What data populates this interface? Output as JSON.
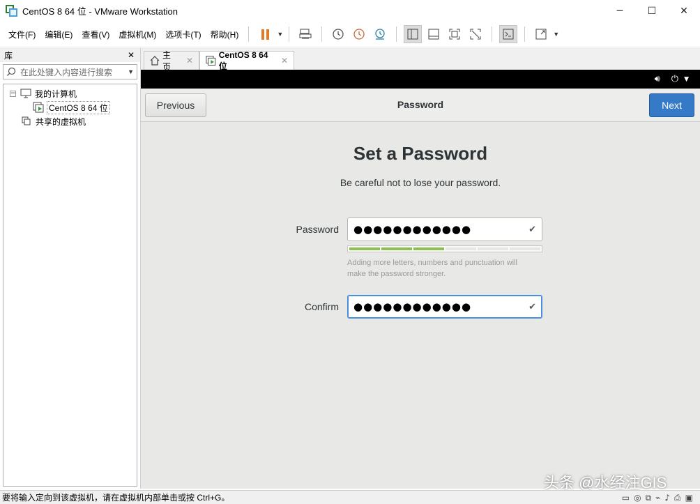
{
  "window": {
    "title": "CentOS 8 64 位 - VMware Workstation",
    "minimize_glyph": "─",
    "maximize_glyph": "☐",
    "close_glyph": "✕"
  },
  "menu": [
    "文件(F)",
    "编辑(E)",
    "查看(V)",
    "虚拟机(M)",
    "选项卡(T)",
    "帮助(H)"
  ],
  "library": {
    "header": "库",
    "close_glyph": "✕",
    "search_placeholder": "在此处键入内容进行搜索",
    "tree": {
      "my_computer": "我的计算机",
      "vm": "CentOS 8 64 位",
      "shared": "共享的虚拟机"
    }
  },
  "tabs": [
    {
      "label": "主页",
      "icon": "home-icon"
    },
    {
      "label": "CentOS 8 64 位",
      "icon": "vm-icon"
    }
  ],
  "installer": {
    "previous_label": "Previous",
    "title": "Password",
    "next_label": "Next",
    "heading": "Set a Password",
    "subheading": "Be careful not to lose your password.",
    "password_label": "Password",
    "password_value": "●●●●●●●●●●●●",
    "strength_level": 0.5,
    "hint_line1": "Adding more letters, numbers and punctuation will",
    "hint_line2": "make the password stronger.",
    "confirm_label": "Confirm",
    "confirm_value": "●●●●●●●●●●●●"
  },
  "watermark": "头条 @水经注GIS",
  "statusbar": {
    "text": "要将输入定向到该虚拟机，请在虚拟机内部单击或按 Ctrl+G。"
  },
  "colors": {
    "accent": "#3579c7",
    "strength": "#8cc152",
    "pause": "#e07b2a"
  }
}
